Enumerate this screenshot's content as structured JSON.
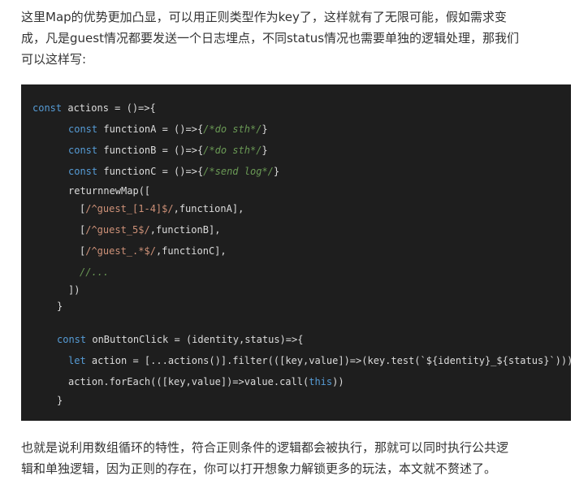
{
  "intro_text": "这里Map的优势更加凸显，可以用正则类型作为key了，这样就有了无限可能，假如需求变\n成，凡是guest情况都要发送一个日志埋点，不同status情况也需要单独的逻辑处理，那我们\n可以这样写:",
  "code": {
    "l1": {
      "kw": "const",
      "t": " actions = ()=>{"
    },
    "l2": {
      "kw": "const",
      "t": " functionA = ()=>{",
      "cm": "/*do sth*/",
      "e": "}"
    },
    "l3": {
      "kw": "const",
      "t": " functionB = ()=>{",
      "cm": "/*do sth*/",
      "e": "}"
    },
    "l4": {
      "kw": "const",
      "t": " functionC = ()=>{",
      "cm": "/*send log*/",
      "e": "}"
    },
    "l5": {
      "t": "returnnewMap(["
    },
    "l6": {
      "a": "[",
      "rx": "/^guest_[1-4]$/",
      "b": ",functionA],"
    },
    "l7": {
      "a": "[",
      "rx": "/^guest_5$/",
      "b": ",functionB],"
    },
    "l8": {
      "a": "[",
      "rx": "/^guest_.*$/",
      "b": ",functionC],"
    },
    "l9": {
      "cm": "//..."
    },
    "l10": {
      "t": "])"
    },
    "l11": {
      "t": "}"
    },
    "l12": {
      "kw": "const",
      "t": " onButtonClick = (identity,status)=>{"
    },
    "l13": {
      "kw": "let",
      "t": " action = [...actions()].filter(([key,value])=>(key.test(`${identity}_${status}`)))"
    },
    "l14": {
      "t": "action.forEach(([key,value])=>value.call(",
      "kw": "this",
      "e": "))"
    },
    "l15": {
      "t": "}"
    }
  },
  "outro_text": "也就是说利用数组循环的特性，符合正则条件的逻辑都会被执行，那就可以同时执行公共逻\n辑和单独逻辑，因为正则的存在，你可以打开想象力解锁更多的玩法，本文就不赘述了。"
}
